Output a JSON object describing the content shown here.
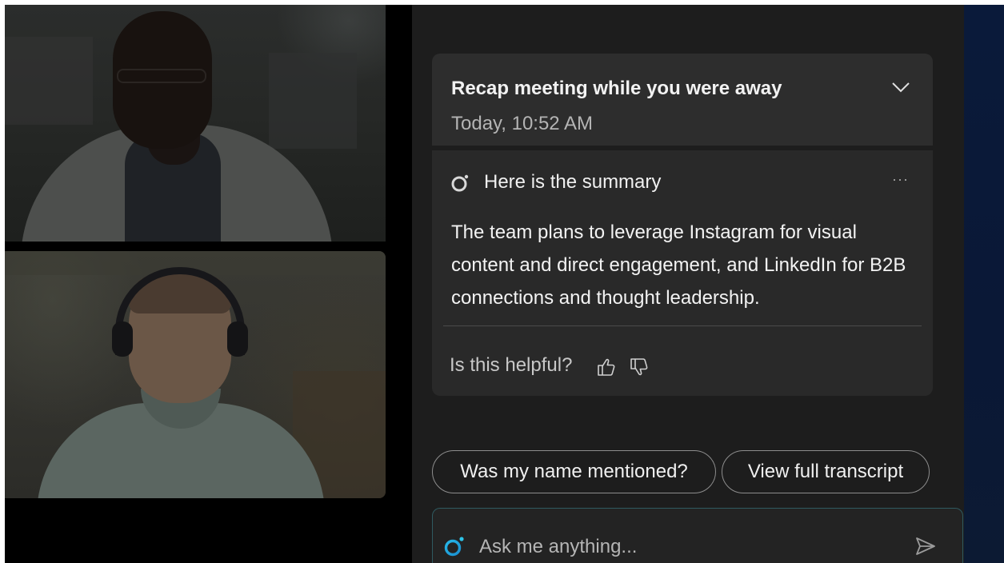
{
  "recap": {
    "title": "Recap meeting while you were away",
    "time": "Today, 10:52 AM",
    "expand_icon": "chevron-down-icon"
  },
  "summary": {
    "icon": "copilot-icon",
    "heading": "Here is the summary",
    "more_label": "···",
    "text": "The team plans to leverage Instagram for visual content and direct engagement, and LinkedIn for B2B connections and thought leadership.",
    "feedback_prompt": "Is this helpful?",
    "thumbs_up_icon": "thumbs-up-icon",
    "thumbs_down_icon": "thumbs-down-icon"
  },
  "suggestions": [
    {
      "label": "Was my name mentioned?"
    },
    {
      "label": "View full transcript"
    }
  ],
  "ask": {
    "placeholder": "Ask me anything...",
    "icon": "copilot-icon",
    "send_icon": "send-icon"
  },
  "colors": {
    "panel_bg": "#1d1d1d",
    "card_bg": "#2d2d2d",
    "accent": "#1aa0c8"
  }
}
